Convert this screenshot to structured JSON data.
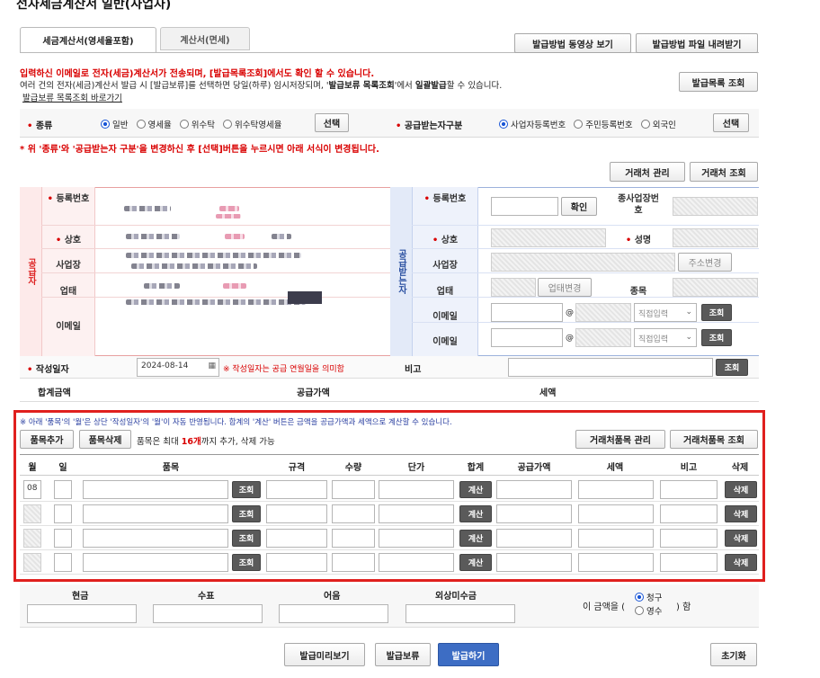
{
  "page_title": "전자세금계산서 일반(사업자)",
  "tabs": [
    {
      "label": "세금계산서(영세율포함)"
    },
    {
      "label": "계산서(면세)"
    }
  ],
  "top_buttons": {
    "video": "발급방법 동영상 보기",
    "download": "발급방법 파일 내려받기"
  },
  "notice": {
    "line1": "입력하신 이메일로 전자(세금)계산서가 전송되며, [발급목록조회]에서도 확인 할 수 있습니다.",
    "line2a": "여러 건의 전자(세금)계산서 발급 시 [발급보류]를 선택하면 당일(하루) 임시저장되며, '",
    "line2b": "발급보류 목록조회",
    "line2c": "'에서 ",
    "line2d": "일괄발급",
    "line2e": "할 수 있습니다.",
    "link": "발급보류 목록조회 바로가기",
    "list_button": "발급목록 조회"
  },
  "type_row": {
    "label": "종류",
    "options": [
      "일반",
      "영세율",
      "위수탁",
      "위수탁영세율"
    ],
    "select": "선택",
    "recv_label": "공급받는자구분",
    "recv_options": [
      "사업자등록번호",
      "주민등록번호",
      "외국인"
    ],
    "recv_select": "선택"
  },
  "warning": "* 위 '종류'와 '공급받는자 구분'을 변경하신 후 [선택]버튼을 누르시면 아래 서식이 변경됩니다.",
  "partner_buttons": {
    "manage": "거래처 관리",
    "lookup": "거래처 조회"
  },
  "supplier": {
    "side": "공급자",
    "reg_no": "등록번호",
    "name": "상호",
    "address": "사업장",
    "biz_type": "업태",
    "email": "이메일"
  },
  "receiver": {
    "side": "공급받는자",
    "reg_no": "등록번호",
    "confirm": "확인",
    "sub_branch": "종사업장번호",
    "name": "상호",
    "rep": "성명",
    "address": "사업장",
    "change_addr": "주소변경",
    "biz_type": "업태",
    "change_biz": "업태변경",
    "item": "종목",
    "email1": "이메일",
    "email2": "이메일",
    "at": "@",
    "direct_input": "직접입력",
    "lookup": "조회"
  },
  "date_row": {
    "label": "작성일자",
    "value": "2024-08-14",
    "note": "※ 작성일자는 공급 연월일을 의미함",
    "memo_label": "비고",
    "lookup": "조회"
  },
  "totals": {
    "total": "합계금액",
    "supply": "공급가액",
    "tax": "세액"
  },
  "items_section": {
    "notice": "※ 아래 '품목'의 '월'은 상단 '작성일자'의 '월'이 자동 반영됩니다. 합계의 '계산' 버튼은 금액을 공급가액과 세액으로 계산할 수 있습니다.",
    "add": "품목추가",
    "remove": "품목삭제",
    "limit_a": "품목은 최대 ",
    "limit_b": "16개",
    "limit_c": "까지 추가, 삭제 가능",
    "manage": "거래처품목 관리",
    "lookup": "거래처품목 조회",
    "headers": [
      "월",
      "일",
      "품목",
      "규격",
      "수량",
      "단가",
      "합계",
      "공급가액",
      "세액",
      "비고",
      "삭제"
    ],
    "row_buttons": {
      "lookup": "조회",
      "calc": "계산",
      "delete": "삭제"
    },
    "first_month": "08"
  },
  "payment": {
    "cash": "현금",
    "check": "수표",
    "note": "어음",
    "credit": "외상미수금",
    "amount_label": "이 금액을 (",
    "claim": "청구",
    "receipt": "영수",
    "suffix": ") 함"
  },
  "footer_buttons": {
    "preview": "발급미리보기",
    "hold": "발급보류",
    "issue": "발급하기",
    "reset": "초기화"
  }
}
